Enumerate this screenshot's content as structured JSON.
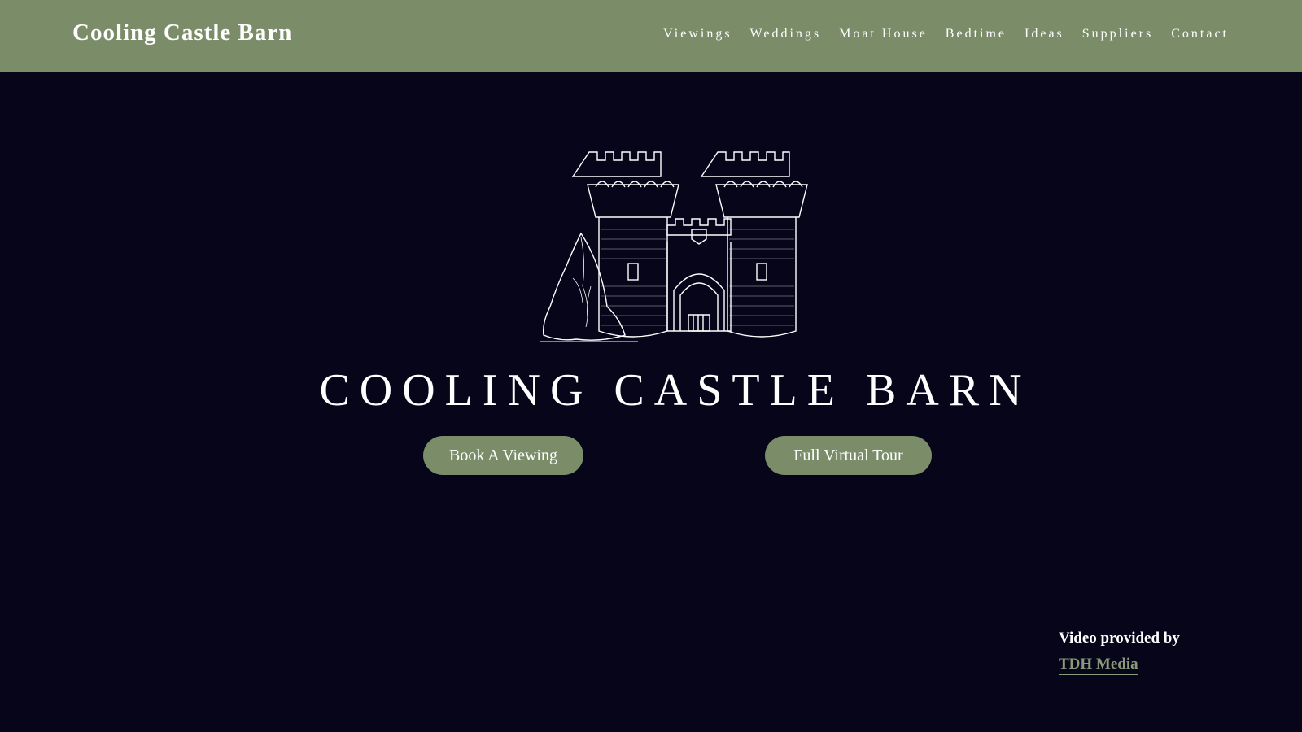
{
  "header": {
    "site_title": "Cooling Castle Barn",
    "nav": [
      "Viewings",
      "Weddings",
      "Moat House",
      "Bedtime",
      "Ideas",
      "Suppliers",
      "Contact"
    ]
  },
  "hero": {
    "logo_icon": "castle-gatehouse-illustration",
    "title": "COOLING CASTLE BARN",
    "buttons": {
      "book": "Book A Viewing",
      "tour": "Full Virtual Tour"
    }
  },
  "credit": {
    "label": "Video provided by",
    "link": "TDH Media"
  },
  "colors": {
    "header_bg": "#7b8c69",
    "page_bg": "#07051a",
    "button_bg": "#7b8c69",
    "link": "#8a9a78"
  }
}
